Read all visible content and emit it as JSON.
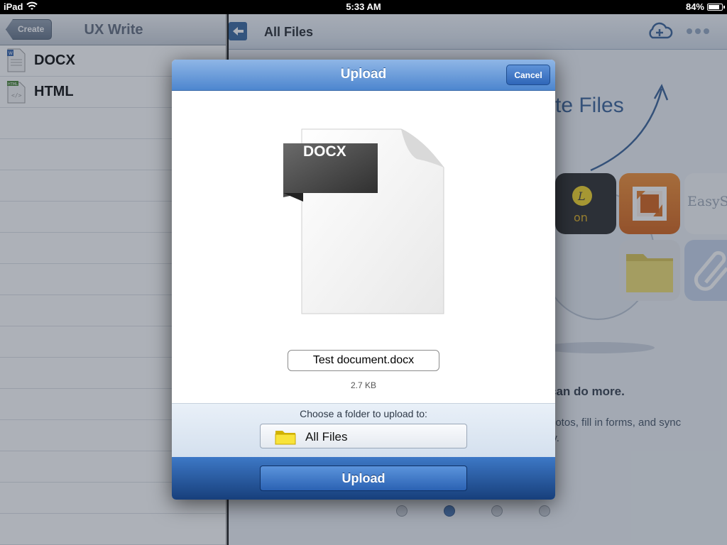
{
  "status_bar": {
    "carrier": "iPad",
    "time": "5:33 AM",
    "battery_percent": "84%",
    "battery_level": 0.84,
    "wifi_icon": "wifi-icon"
  },
  "left_pane": {
    "title": "UX Write",
    "create_label": "Create",
    "files": [
      {
        "label": "DOCX",
        "icon": "docx-file-icon"
      },
      {
        "label": "HTML",
        "icon": "html-file-icon"
      }
    ]
  },
  "right_pane": {
    "title": "All Files",
    "headline_fragment": "te Files",
    "tagline_fragment": "can do more.",
    "desc_line1": "hotos, fill in forms, and sync",
    "desc_line2": "ly.",
    "app_badge_text": "on",
    "app_easy_text": "EasyS",
    "page_dots": {
      "count": 4,
      "active": 1
    }
  },
  "modal": {
    "title": "Upload",
    "cancel_label": "Cancel",
    "doc_type_label": "DOCX",
    "filename": "Test document.docx",
    "filesize": "2.7 KB",
    "folder_prompt": "Choose a folder to upload to:",
    "folder_name": "All Files",
    "upload_label": "Upload"
  },
  "colors": {
    "accent_blue": "#2f66b8",
    "modal_header_blue": "#4d86cf",
    "footer_blue": "#173f7b"
  }
}
